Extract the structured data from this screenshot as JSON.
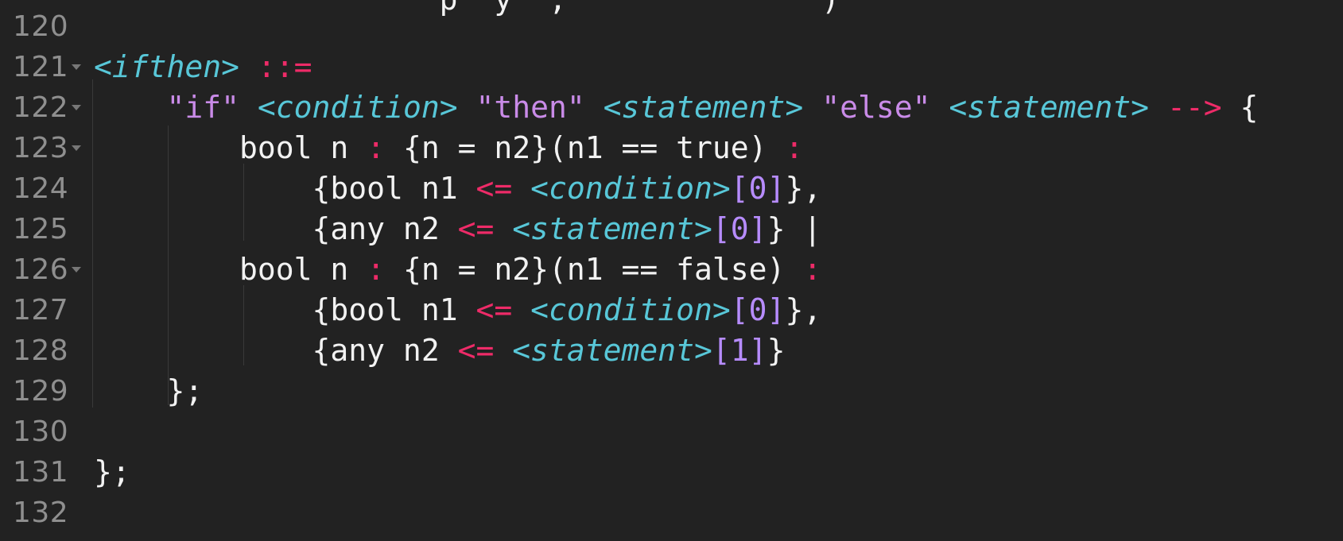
{
  "editor": {
    "background": "#222222",
    "syntax_colors": {
      "nonterminal": "#58c7d8",
      "operator": "#ee2b68",
      "string": "#c98be8",
      "index": "#b78cff",
      "plain": "#f2f2f2",
      "line_number": "#8f8f8f"
    },
    "fold_icon": "chevron-down-icon",
    "top_partial_text": "                   p  y  ;              )",
    "lines": [
      {
        "number": "120",
        "fold": false,
        "text": ""
      },
      {
        "number": "121",
        "fold": true,
        "text": "<ifthen> ::="
      },
      {
        "number": "122",
        "fold": true,
        "text": "    \"if\" <condition> \"then\" <statement> \"else\" <statement> --> {"
      },
      {
        "number": "123",
        "fold": true,
        "text": "        bool n : {n = n2}(n1 == true) :"
      },
      {
        "number": "124",
        "fold": false,
        "text": "            {bool n1 <= <condition>[0]},"
      },
      {
        "number": "125",
        "fold": false,
        "text": "            {any n2 <= <statement>[0]} |"
      },
      {
        "number": "126",
        "fold": true,
        "text": "        bool n : {n = n2}(n1 == false) :"
      },
      {
        "number": "127",
        "fold": false,
        "text": "            {bool n1 <= <condition>[0]},"
      },
      {
        "number": "128",
        "fold": false,
        "text": "            {any n2 <= <statement>[1]}"
      },
      {
        "number": "129",
        "fold": false,
        "text": "    };"
      },
      {
        "number": "130",
        "fold": false,
        "text": ""
      },
      {
        "number": "131",
        "fold": false,
        "text": "};"
      },
      {
        "number": "132",
        "fold": false,
        "text": ""
      }
    ],
    "tokens": {
      "l121_a": "<ifthen>",
      "l121_b": "::=",
      "l122_a": "\"if\"",
      "l122_b": "<condition>",
      "l122_c": "\"then\"",
      "l122_d": "<statement>",
      "l122_e": "\"else\"",
      "l122_f": "<statement>",
      "l122_g": "-->",
      "l122_h": "{",
      "l123_a": "bool n",
      "l123_b": ":",
      "l123_c": "{n = n2}(n1 == true)",
      "l123_d": ":",
      "l124_a": "{bool n1",
      "l124_b": "<=",
      "l124_c": "<condition>",
      "l124_d": "[0]",
      "l124_e": "},",
      "l125_a": "{any n2",
      "l125_b": "<=",
      "l125_c": "<statement>",
      "l125_d": "[0]",
      "l125_e": "}",
      "l125_f": "|",
      "l126_a": "bool n",
      "l126_b": ":",
      "l126_c": "{n = n2}(n1 == false)",
      "l126_d": ":",
      "l127_a": "{bool n1",
      "l127_b": "<=",
      "l127_c": "<condition>",
      "l127_d": "[0]",
      "l127_e": "},",
      "l128_a": "{any n2",
      "l128_b": "<=",
      "l128_c": "<statement>",
      "l128_d": "[1]",
      "l128_e": "}",
      "l129_a": "};",
      "l131_a": "};"
    }
  }
}
